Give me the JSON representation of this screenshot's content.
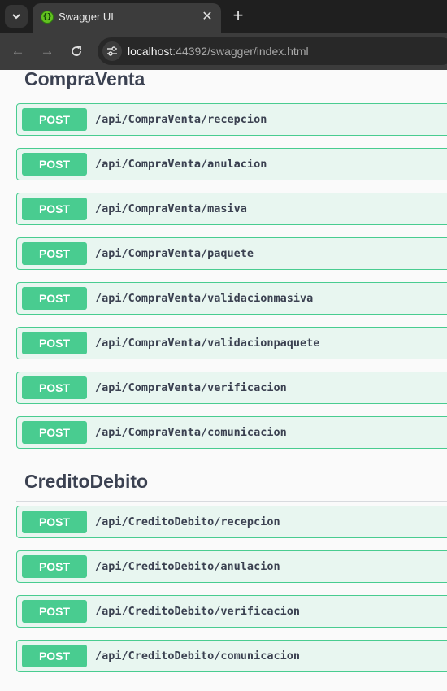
{
  "browser": {
    "tab_title": "Swagger UI",
    "url_host": "localhost",
    "url_rest": ":44392/swagger/index.html"
  },
  "sections": [
    {
      "title": "CompraVenta",
      "operations": [
        {
          "method": "POST",
          "path": "/api/CompraVenta/recepcion"
        },
        {
          "method": "POST",
          "path": "/api/CompraVenta/anulacion"
        },
        {
          "method": "POST",
          "path": "/api/CompraVenta/masiva"
        },
        {
          "method": "POST",
          "path": "/api/CompraVenta/paquete"
        },
        {
          "method": "POST",
          "path": "/api/CompraVenta/validacionmasiva"
        },
        {
          "method": "POST",
          "path": "/api/CompraVenta/validacionpaquete"
        },
        {
          "method": "POST",
          "path": "/api/CompraVenta/verificacion"
        },
        {
          "method": "POST",
          "path": "/api/CompraVenta/comunicacion"
        }
      ]
    },
    {
      "title": "CreditoDebito",
      "operations": [
        {
          "method": "POST",
          "path": "/api/CreditoDebito/recepcion"
        },
        {
          "method": "POST",
          "path": "/api/CreditoDebito/anulacion"
        },
        {
          "method": "POST",
          "path": "/api/CreditoDebito/verificacion"
        },
        {
          "method": "POST",
          "path": "/api/CreditoDebito/comunicacion"
        }
      ]
    }
  ],
  "colors": {
    "post_accent": "#49cc90",
    "post_background": "#e8f6f0",
    "text": "#3b4151"
  }
}
